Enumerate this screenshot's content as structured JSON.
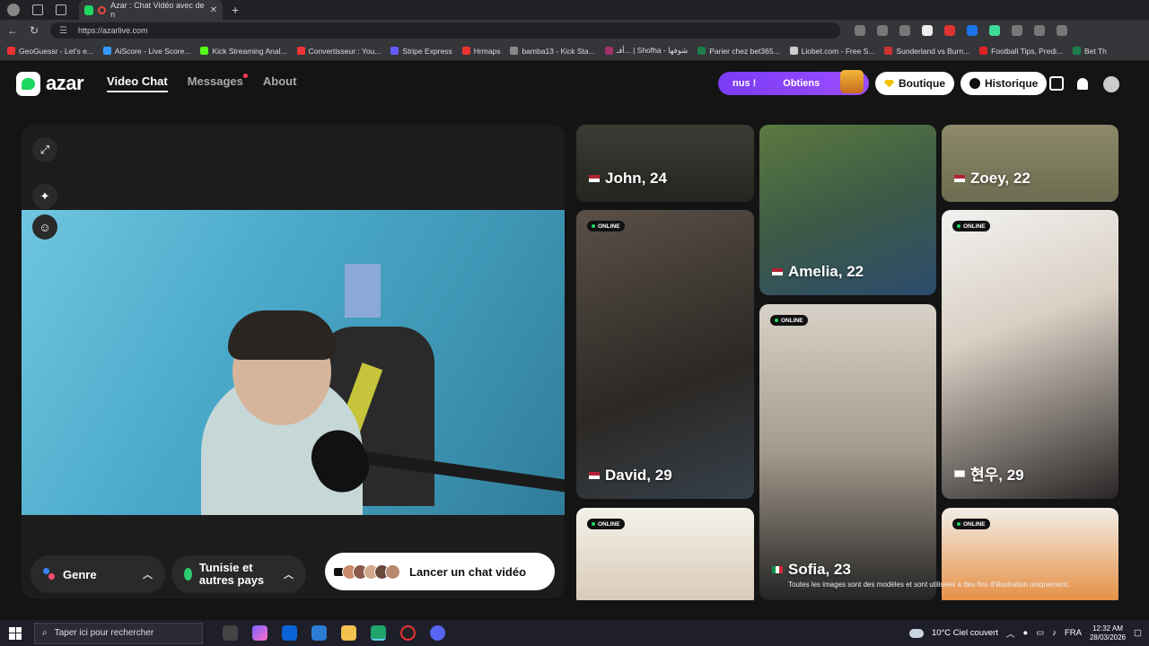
{
  "browser": {
    "tab_title": "Azar : Chat Vidéo avec de n",
    "url": "https://azarlive.com",
    "bookmarks": [
      "GeoGuessr - Let's e...",
      "AiScore - Live Score...",
      "Kick Streaming Anal...",
      "Convertisseur : You...",
      "Stripe Express",
      "Hrmaps",
      "bamba13 - Kick Sta...",
      "أفـ... | Shofha - شوفها",
      "Parier chez bet365...",
      "Liobet.com - Free S...",
      "Sunderland vs Burn...",
      "Football Tips, Predi...",
      "Bet Th"
    ]
  },
  "header": {
    "logo_text": "azar",
    "nav": {
      "video_chat": "Video Chat",
      "messages": "Messages",
      "about": "About"
    },
    "promo": {
      "left": "nus !",
      "right": "Obtiens"
    },
    "boutique": "Boutique",
    "historique": "Historique"
  },
  "controls": {
    "genre": "Genre",
    "country": "Tunisie et autres pays",
    "launch": "Lancer un chat vidéo"
  },
  "profiles": [
    {
      "name": "John, 24",
      "flag": "us",
      "online": false
    },
    {
      "name": "Amelia, 22",
      "flag": "us",
      "online": false
    },
    {
      "name": "Zoey, 22",
      "flag": "us",
      "online": false
    },
    {
      "name": "David, 29",
      "flag": "us",
      "online": true
    },
    {
      "name": "Sofia, 23",
      "flag": "it",
      "online": true
    },
    {
      "name": "현우, 29",
      "flag": "kr",
      "online": true
    },
    {
      "name": "",
      "flag": "",
      "online": true
    },
    {
      "name": "",
      "flag": "",
      "online": true
    }
  ],
  "online_label": "ONLINE",
  "disclaimer": "Toutes les images sont des modèles et sont utilisées à des fins d'illustration uniquement.",
  "taskbar": {
    "search_placeholder": "Taper ici pour rechercher",
    "weather": "10°C  Ciel couvert",
    "lang": "FRA",
    "time": "12:32 AM",
    "date": "28/03/2026"
  },
  "colors": {
    "brand_green": "#1ed760",
    "promo_purple": "#8b45f8",
    "online_green": "#1ed760"
  }
}
